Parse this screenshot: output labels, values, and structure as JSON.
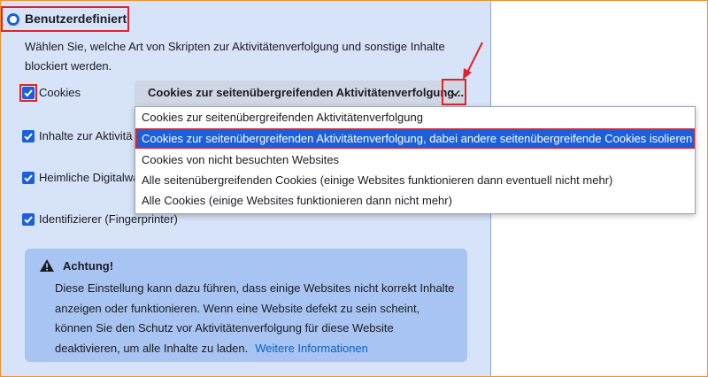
{
  "custom_option": {
    "label": "Benutzerdefiniert",
    "description": "Wählen Sie, welche Art von Skripten zur Aktivitätenverfolgung und sonstige Inhalte blockiert werden."
  },
  "checkboxes": {
    "cookies": {
      "label": "Cookies",
      "checked": true
    },
    "tracking_content": {
      "label": "Inhalte zur Aktivitä",
      "checked": true
    },
    "cryptominers": {
      "label": "Heimliche Digitalwä",
      "checked": true
    },
    "fingerprinters": {
      "label": "Identifizierer (Fingerprinter)",
      "checked": true
    }
  },
  "cookies_select": {
    "value": "Cookies zur seitenübergreifenden Aktivitätenverfolgung...",
    "options": [
      "Cookies zur seitenübergreifenden Aktivitätenverfolgung",
      "Cookies zur seitenübergreifenden Aktivitätenverfolgung, dabei andere seitenübergreifende Cookies isolieren",
      "Cookies von nicht besuchten Websites",
      "Alle seitenübergreifenden Cookies (einige Websites funktionieren dann eventuell nicht mehr)",
      "Alle Cookies (einige Websites funktionieren dann nicht mehr)"
    ],
    "selected_index": 1
  },
  "warning": {
    "title": "Achtung!",
    "body": "Diese Einstellung kann dazu führen, dass einige Websites nicht korrekt Inhalte anzeigen oder funktionieren. Wenn eine Website defekt zu sein scheint, können Sie den Schutz vor Aktivitätenverfolgung für diese Website deaktivieren, um alle Inhalte zu laden.",
    "link": "Weitere Informationen"
  },
  "colors": {
    "accent": "#1a5fdb",
    "highlight_border": "#e0232b",
    "panel_bg": "#d6e3f8",
    "warning_bg": "#a8c4f2",
    "arrow": "#e0232b"
  },
  "icons": [
    "radio-selected-icon",
    "checkbox-checked-icon",
    "chevron-down-icon",
    "warning-icon",
    "annotation-arrow-icon"
  ]
}
